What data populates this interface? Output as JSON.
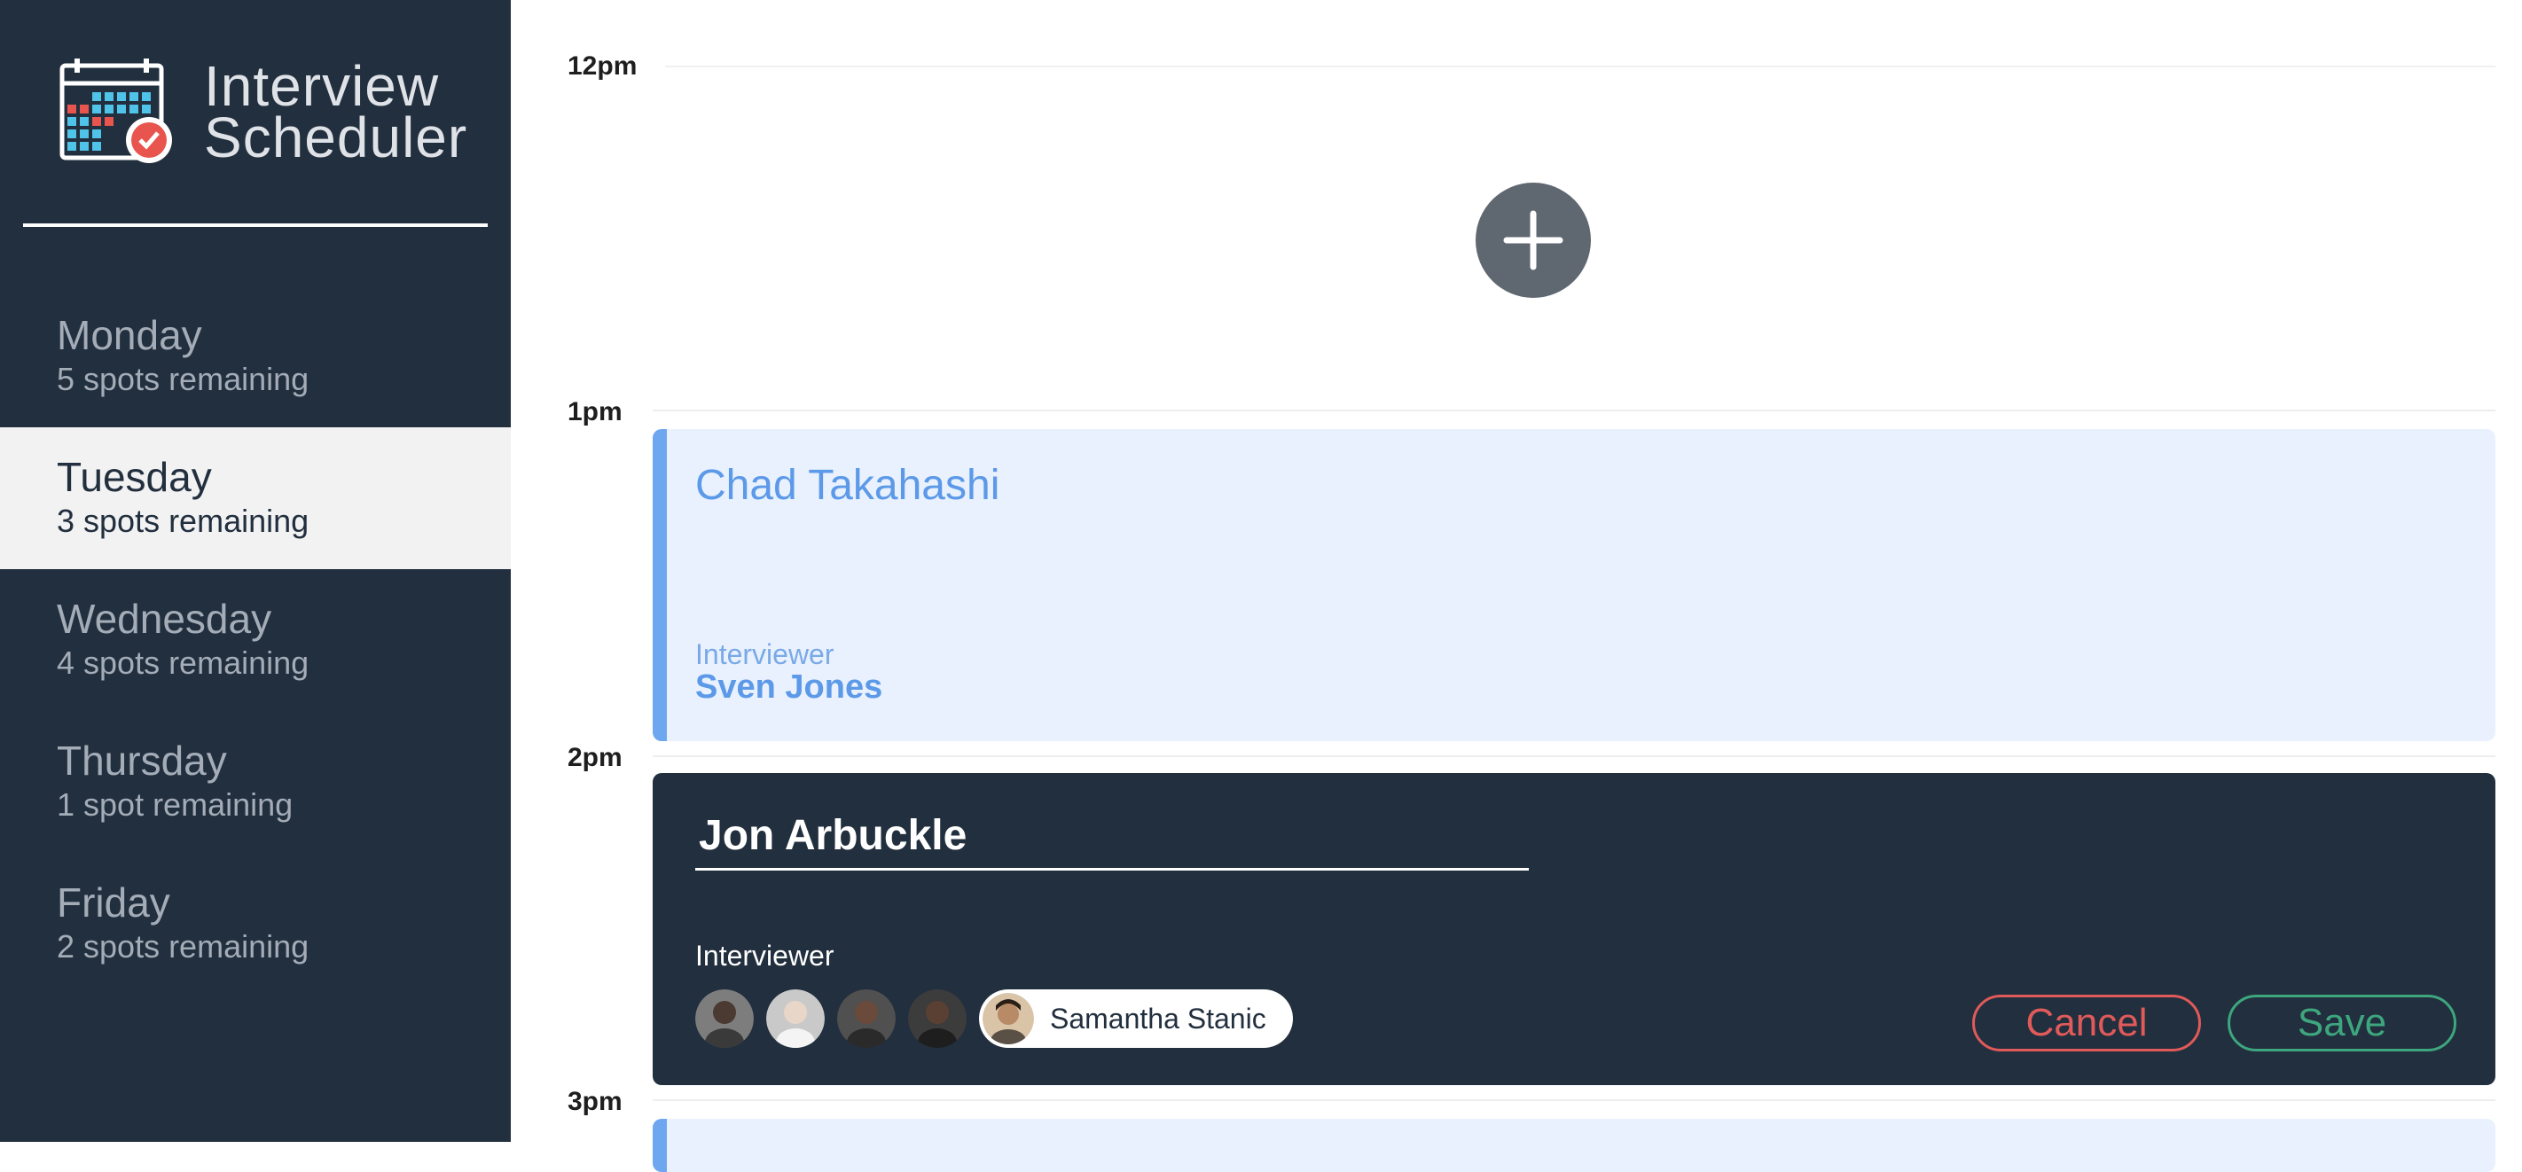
{
  "app": {
    "title_line1": "Interview",
    "title_line2": "Scheduler",
    "logo_icon": "calendar-check-icon"
  },
  "sidebar": {
    "days": [
      {
        "name": "Monday",
        "spots": "5 spots remaining",
        "selected": false
      },
      {
        "name": "Tuesday",
        "spots": "3 spots remaining",
        "selected": true
      },
      {
        "name": "Wednesday",
        "spots": "4 spots remaining",
        "selected": false
      },
      {
        "name": "Thursday",
        "spots": "1 spot remaining",
        "selected": false
      },
      {
        "name": "Friday",
        "spots": "2 spots remaining",
        "selected": false
      }
    ]
  },
  "schedule": {
    "times": [
      "12pm",
      "1pm",
      "2pm",
      "3pm"
    ],
    "add_icon": "plus-icon",
    "booked": {
      "student": "Chad Takahashi",
      "interviewer_label": "Interviewer",
      "interviewer_name": "Sven Jones"
    },
    "edit": {
      "student_value": "Jon Arbuckle",
      "interviewer_label": "Interviewer",
      "selected_interviewer": "Samantha Stanic",
      "cancel_label": "Cancel",
      "save_label": "Save"
    }
  },
  "colors": {
    "sidebar_bg": "#222f3e",
    "accent_blue": "#5c99e8",
    "cancel_red": "#e05a5a",
    "save_green": "#3ea67e"
  }
}
